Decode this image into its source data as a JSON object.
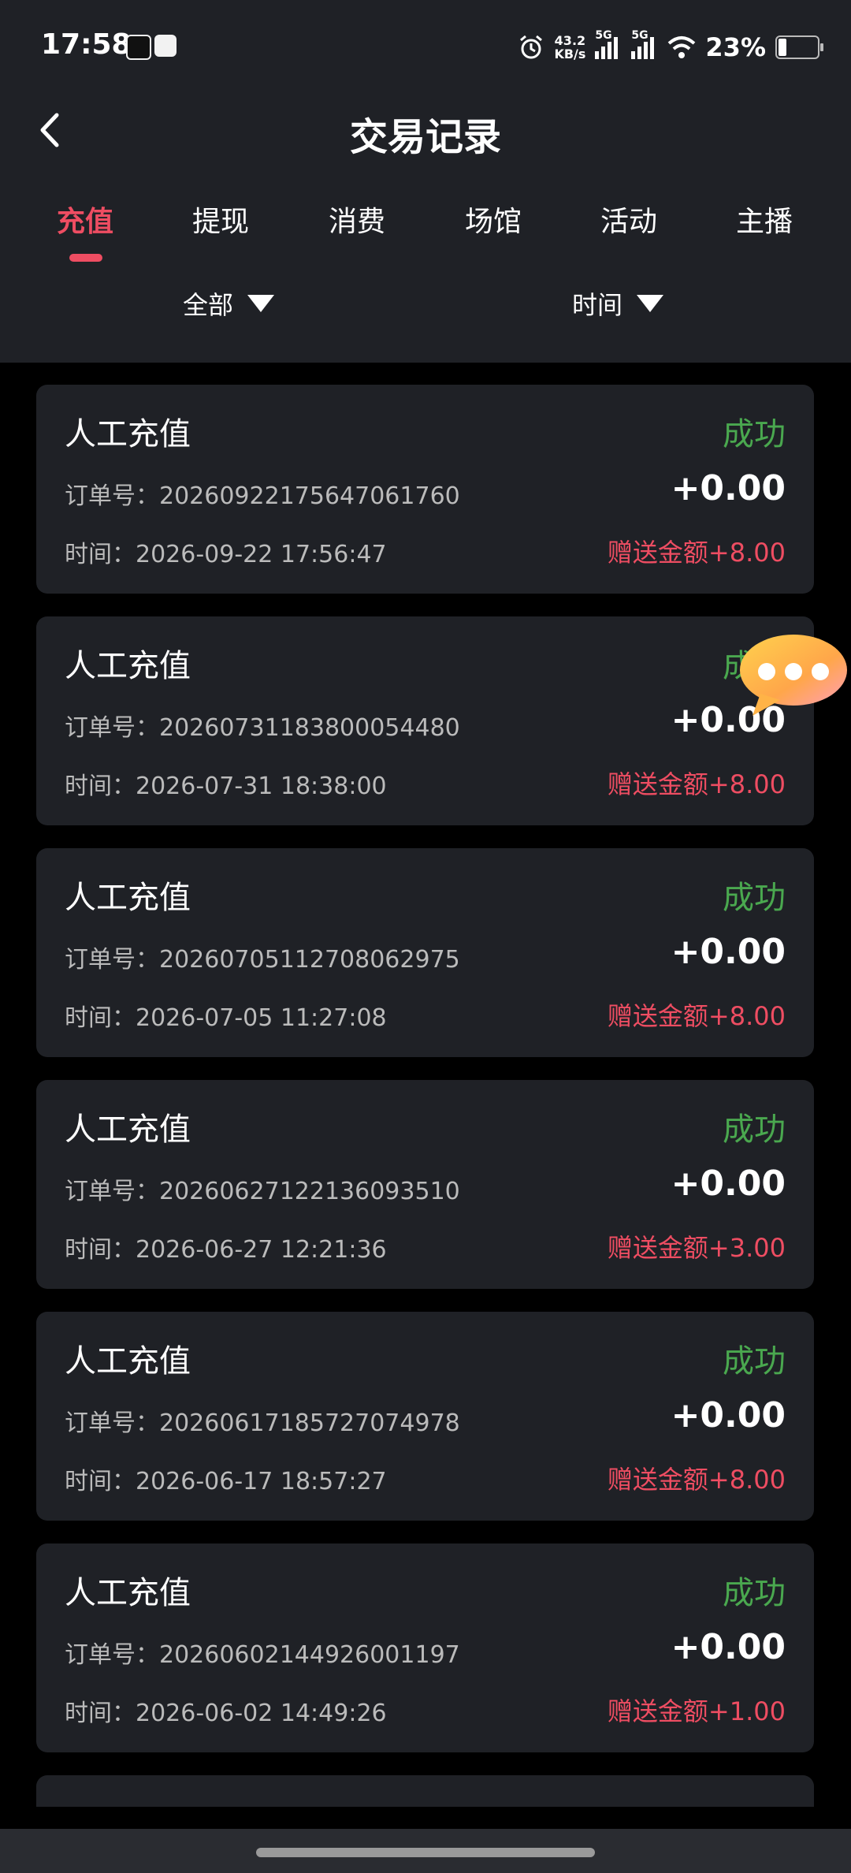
{
  "status_bar": {
    "time": "17:58",
    "net_speed_value": "43.2",
    "net_speed_unit": "KB/s",
    "sig1": "5G",
    "sig2": "5G",
    "battery": "23%"
  },
  "header": {
    "title": "交易记录"
  },
  "tabs": [
    {
      "label": "充值",
      "active": true
    },
    {
      "label": "提现",
      "active": false
    },
    {
      "label": "消费",
      "active": false
    },
    {
      "label": "场馆",
      "active": false
    },
    {
      "label": "活动",
      "active": false
    },
    {
      "label": "主播",
      "active": false
    }
  ],
  "filters": {
    "type": "全部",
    "time": "时间"
  },
  "records": [
    {
      "type": "人工充值",
      "status": "成功",
      "order": "订单号：20260922175647061760",
      "amount": "+0.00",
      "time": "时间：2026-09-22 17:56:47",
      "bonus": "赠送金额+8.00"
    },
    {
      "type": "人工充值",
      "status": "成功",
      "order": "订单号：20260731183800054480",
      "amount": "+0.00",
      "time": "时间：2026-07-31 18:38:00",
      "bonus": "赠送金额+8.00"
    },
    {
      "type": "人工充值",
      "status": "成功",
      "order": "订单号：20260705112708062975",
      "amount": "+0.00",
      "time": "时间：2026-07-05 11:27:08",
      "bonus": "赠送金额+8.00"
    },
    {
      "type": "人工充值",
      "status": "成功",
      "order": "订单号：20260627122136093510",
      "amount": "+0.00",
      "time": "时间：2026-06-27 12:21:36",
      "bonus": "赠送金额+3.00"
    },
    {
      "type": "人工充值",
      "status": "成功",
      "order": "订单号：20260617185727074978",
      "amount": "+0.00",
      "time": "时间：2026-06-17 18:57:27",
      "bonus": "赠送金额+8.00"
    },
    {
      "type": "人工充值",
      "status": "成功",
      "order": "订单号：20260602144926001197",
      "amount": "+0.00",
      "time": "时间：2026-06-02 14:49:26",
      "bonus": "赠送金额+1.00"
    }
  ],
  "colors": {
    "accent": "#ee4d62",
    "success": "#4aa84f",
    "card_bg": "#1f2126",
    "page_bg": "#000000"
  }
}
